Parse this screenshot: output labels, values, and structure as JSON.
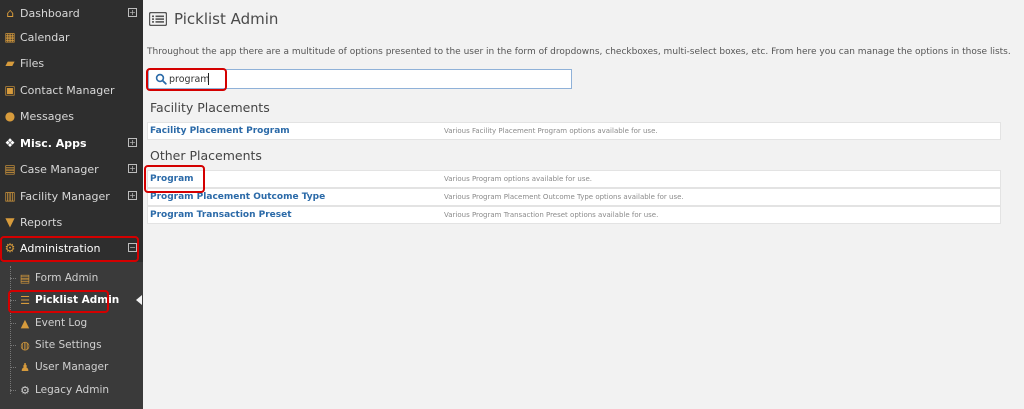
{
  "sidebar": {
    "items": [
      {
        "label": "Dashboard",
        "icon": "home-icon",
        "expander": "+"
      },
      {
        "label": "Calendar",
        "icon": "calendar-icon"
      },
      {
        "label": "Files",
        "icon": "folder-icon"
      },
      {
        "label": "Contact Manager",
        "icon": "contact-card-icon"
      },
      {
        "label": "Messages",
        "icon": "chat-bubbles-icon"
      },
      {
        "label": "Misc. Apps",
        "icon": "cubes-icon",
        "expander": "+"
      },
      {
        "label": "Case Manager",
        "icon": "briefcase-icon",
        "expander": "+"
      },
      {
        "label": "Facility Manager",
        "icon": "building-icon",
        "expander": "+"
      },
      {
        "label": "Reports",
        "icon": "filter-icon"
      },
      {
        "label": "Administration",
        "icon": "cogs-icon",
        "expander": "−"
      }
    ],
    "sub_items": [
      {
        "label": "Form Admin",
        "icon": "form-icon"
      },
      {
        "label": "Picklist Admin",
        "icon": "list-icon"
      },
      {
        "label": "Event Log",
        "icon": "warning-icon"
      },
      {
        "label": "Site Settings",
        "icon": "globe-icon"
      },
      {
        "label": "User Manager",
        "icon": "users-icon"
      },
      {
        "label": "Legacy Admin",
        "icon": "gears-icon"
      }
    ]
  },
  "main": {
    "title": "Picklist Admin",
    "description": "Throughout the app there are a multitude of options presented to the user in the form of dropdowns, checkboxes, multi-select boxes, etc. From here you can manage the options in those lists.",
    "search": {
      "value": "program"
    },
    "sections": [
      {
        "title": "Facility Placements",
        "rows": [
          {
            "name": "Facility Placement Program",
            "description": "Various Facility Placement Program options available for use."
          }
        ]
      },
      {
        "title": "Other Placements",
        "rows": [
          {
            "name": "Program",
            "description": "Various Program options available for use."
          },
          {
            "name": "Program Placement Outcome Type",
            "description": "Various Program Placement Outcome Type options available for use."
          },
          {
            "name": "Program Transaction Preset",
            "description": "Various Program Transaction Preset options available for use."
          }
        ]
      }
    ]
  },
  "colors": {
    "sidebar_bg": "#2e2e2e",
    "icon_accent": "#d79b3c",
    "link": "#2b6aa8",
    "highlight": "#d40000"
  }
}
